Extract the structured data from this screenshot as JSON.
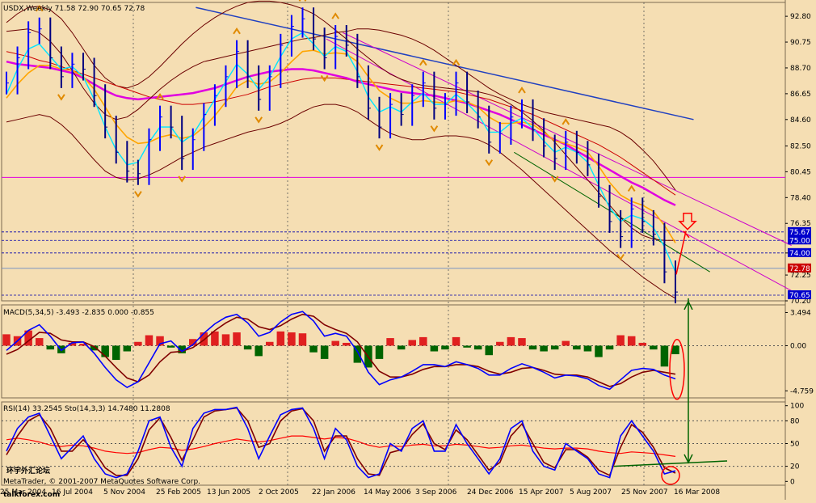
{
  "chart_data": [
    {
      "type": "line",
      "panel": "price",
      "title": "USDX,Weekly  71.58 72.90 70.65 72.78",
      "ohlc_last": {
        "open": 71.58,
        "high": 72.9,
        "low": 70.65,
        "close": 72.78
      },
      "y_ticks": [
        "92.80",
        "90.75",
        "88.70",
        "86.65",
        "84.60",
        "82.50",
        "80.45",
        "78.40",
        "76.35",
        "74.00",
        "72.25",
        "70.20"
      ],
      "price_labels": [
        {
          "text": "75.67",
          "value": 75.67,
          "fill": "#0000cc"
        },
        {
          "text": "75.00",
          "value": 75.0,
          "fill": "#0000cc"
        },
        {
          "text": "74.00",
          "value": 74.0,
          "fill": "#0000cc"
        },
        {
          "text": "72.78",
          "value": 72.78,
          "fill": "#cc0000"
        },
        {
          "text": "70.65",
          "value": 70.65,
          "fill": "#0000cc"
        }
      ],
      "ylim": [
        70.2,
        93.9
      ],
      "horizontal_levels": [
        75.67,
        75.0,
        74.0,
        70.65
      ],
      "current_price_line": 72.78,
      "magenta_level": 80.0,
      "series": [
        {
          "values": [
            87.5,
            89.5,
            91.5,
            91.8,
            89.5,
            88.0,
            89.0,
            88.6,
            86.5,
            84.0,
            82.0,
            80.5,
            80.3,
            83.0,
            84.8,
            84.0,
            81.5,
            83.0,
            85.0,
            86.5,
            88.0,
            90.0,
            88.0,
            86.2,
            88.0,
            90.5,
            92.0,
            92.6,
            91.0,
            89.5,
            91.2,
            90.5,
            88.0,
            85.5,
            84.0,
            85.8,
            85.0,
            86.5,
            87.5,
            85.5,
            85.8,
            87.5,
            86.0,
            84.8,
            82.8,
            83.5,
            84.8,
            85.3,
            83.8,
            82.5,
            81.5,
            82.8,
            82.0,
            81.0,
            78.5,
            76.5,
            75.3,
            77.5,
            76.5,
            75.5,
            72.5,
            70.9
          ]
        },
        {
          "values": [
            86.6,
            88.6,
            90.2,
            90.6,
            89.6,
            88.6,
            88.8,
            88.0,
            86.2,
            84.0,
            82.2,
            81.0,
            81.2,
            82.8,
            84.0,
            84.0,
            82.8,
            83.4,
            84.8,
            86.2,
            87.6,
            89.0,
            88.2,
            87.0,
            88.0,
            89.6,
            91.0,
            91.5,
            90.6,
            89.6,
            90.4,
            90.0,
            88.4,
            86.4,
            85.2,
            85.6,
            85.2,
            86.0,
            86.7,
            85.8,
            85.8,
            86.6,
            85.9,
            85.0,
            83.6,
            83.6,
            84.3,
            84.7,
            83.9,
            82.9,
            82.0,
            82.4,
            82.0,
            81.2,
            79.4,
            77.6,
            76.5,
            77.0,
            76.7,
            76.0,
            74.5,
            72.5
          ]
        },
        {
          "values": [
            86.3,
            87.4,
            88.3,
            88.9,
            88.9,
            88.6,
            88.5,
            88.0,
            87.0,
            85.6,
            84.2,
            83.2,
            82.7,
            82.8,
            83.2,
            83.4,
            83.1,
            83.3,
            84.0,
            84.9,
            86.0,
            87.2,
            87.7,
            87.4,
            87.6,
            88.3,
            89.2,
            90.0,
            90.1,
            89.8,
            89.9,
            89.8,
            89.2,
            88.0,
            86.9,
            86.3,
            85.9,
            85.9,
            86.1,
            86.0,
            85.9,
            86.1,
            86.0,
            85.6,
            84.8,
            84.3,
            84.3,
            84.4,
            84.2,
            83.6,
            82.9,
            82.7,
            82.4,
            82.0,
            80.9,
            79.6,
            78.6,
            78.1,
            77.8,
            77.3,
            76.2,
            74.8
          ]
        },
        {
          "values": [
            89.2,
            89.0,
            88.9,
            88.8,
            88.7,
            88.5,
            88.3,
            87.9,
            87.4,
            86.9,
            86.5,
            86.3,
            86.2,
            86.3,
            86.4,
            86.5,
            86.6,
            86.7,
            86.9,
            87.1,
            87.4,
            87.7,
            88.0,
            88.2,
            88.4,
            88.5,
            88.6,
            88.6,
            88.5,
            88.3,
            88.1,
            87.9,
            87.6,
            87.4,
            87.2,
            87.0,
            86.8,
            86.7,
            86.6,
            86.5,
            86.3,
            86.1,
            85.9,
            85.6,
            85.3,
            85.0,
            84.6,
            84.2,
            83.8,
            83.4,
            83.0,
            82.6,
            82.1,
            81.6,
            81.1,
            80.6,
            80.1,
            79.6,
            79.2,
            78.7,
            78.2,
            77.8
          ]
        },
        {
          "values": [
            90.0,
            89.8,
            89.6,
            89.3,
            89.1,
            88.8,
            88.5,
            88.2,
            87.9,
            87.6,
            87.3,
            87.0,
            86.7,
            86.4,
            86.2,
            86.0,
            85.8,
            85.8,
            85.9,
            86.0,
            86.2,
            86.4,
            86.6,
            86.9,
            87.2,
            87.4,
            87.6,
            87.8,
            87.9,
            87.9,
            87.9,
            87.8,
            87.7,
            87.6,
            87.5,
            87.4,
            87.3,
            87.2,
            87.1,
            87.0,
            86.9,
            86.8,
            86.6,
            86.4,
            86.2,
            85.9,
            85.6,
            85.3,
            85.0,
            84.6,
            84.2,
            83.8,
            83.4,
            83.0,
            82.6,
            82.1,
            81.6,
            81.0,
            80.4,
            79.8,
            79.2,
            78.6
          ]
        },
        {
          "values": [
            91.6,
            91.7,
            91.8,
            91.5,
            90.8,
            89.8,
            88.5,
            87.1,
            85.9,
            85.0,
            84.6,
            84.8,
            85.4,
            86.2,
            87.0,
            87.7,
            88.3,
            88.8,
            89.2,
            89.4,
            89.6,
            89.8,
            90.0,
            90.2,
            90.4,
            90.6,
            90.8,
            91.0,
            91.1,
            91.3,
            91.5,
            91.6,
            91.8,
            91.8,
            91.7,
            91.5,
            91.3,
            91.0,
            90.6,
            90.1,
            89.5,
            88.9,
            88.3,
            87.7,
            87.1,
            86.6,
            86.2,
            85.8,
            85.5,
            85.2,
            85.0,
            84.8,
            84.6,
            84.4,
            84.2,
            84.0,
            83.6,
            83.0,
            82.2,
            81.3,
            80.2,
            79.0
          ]
        },
        {
          "values": [
            92.3,
            93.0,
            93.5,
            93.6,
            93.3,
            92.6,
            91.5,
            90.2,
            88.9,
            87.9,
            87.3,
            87.1,
            87.4,
            88.0,
            88.8,
            89.7,
            90.6,
            91.4,
            92.1,
            92.7,
            93.2,
            93.6,
            93.9,
            94.0,
            94.0,
            93.9,
            93.7,
            93.4,
            93.0,
            92.4,
            91.7,
            91.0,
            90.2,
            89.5,
            88.8,
            88.2,
            87.8,
            87.5,
            87.3,
            87.2,
            87.1,
            87.0,
            86.9,
            86.8,
            86.6,
            86.3,
            85.8,
            85.2,
            84.5,
            83.7,
            82.8,
            81.8,
            80.8,
            79.8,
            78.8,
            77.8,
            76.8,
            76.0,
            75.4,
            75.1,
            75.0,
            75.0
          ]
        },
        {
          "values": [
            84.4,
            84.6,
            84.8,
            85.0,
            84.8,
            84.2,
            83.4,
            82.4,
            81.4,
            80.5,
            80.0,
            79.8,
            79.9,
            80.2,
            80.6,
            81.1,
            81.6,
            82.0,
            82.4,
            82.7,
            83.0,
            83.3,
            83.6,
            83.8,
            84.0,
            84.3,
            84.7,
            85.2,
            85.6,
            85.8,
            85.8,
            85.6,
            85.2,
            84.6,
            84.0,
            83.5,
            83.2,
            83.0,
            83.0,
            83.2,
            83.3,
            83.3,
            83.2,
            83.0,
            82.6,
            82.0,
            81.3,
            80.6,
            79.8,
            79.0,
            78.2,
            77.4,
            76.6,
            75.8,
            75.0,
            74.2,
            73.5,
            72.8,
            72.1,
            71.5,
            70.9,
            70.4
          ]
        }
      ],
      "blue_ma_line": {
        "x": [
          0.24,
          0.85
        ],
        "y": [
          93.5,
          84.6
        ]
      },
      "trend_lines": [
        {
          "x": [
            0.42,
            0.97
          ],
          "y": [
            91.5,
            74.6
          ]
        },
        {
          "x": [
            0.4,
            0.97
          ],
          "y": [
            91.0,
            71.0
          ]
        },
        {
          "x": [
            0.63,
            0.87
          ],
          "y": [
            82.0,
            72.5
          ]
        }
      ]
    },
    {
      "type": "bar",
      "panel": "macd",
      "title": "MACD(5,34,5) -3.493 -2.835 0.000 -0.855",
      "y_ticks": [
        "3.494",
        "0.00",
        "-4.759"
      ],
      "ylim": [
        -5.5,
        4.3
      ],
      "histogram": [
        1.2,
        1.0,
        1.6,
        0.8,
        -0.4,
        -0.8,
        0.3,
        0.2,
        -0.5,
        -1.2,
        -1.5,
        -0.6,
        0.4,
        1.1,
        1.0,
        -0.2,
        -0.8,
        0.7,
        1.4,
        1.5,
        1.2,
        1.4,
        -0.4,
        -1.1,
        0.4,
        1.5,
        1.4,
        1.3,
        -0.7,
        -1.4,
        0.5,
        0.3,
        -1.8,
        -2.3,
        -1.4,
        0.8,
        -0.4,
        0.6,
        0.9,
        -0.6,
        -0.4,
        0.9,
        -0.2,
        -0.4,
        -1.0,
        0.4,
        0.9,
        0.8,
        -0.4,
        -0.6,
        -0.4,
        0.5,
        -0.4,
        -0.6,
        -1.2,
        -0.4,
        1.1,
        1.0,
        0.3,
        -0.4,
        -2.2,
        -0.9
      ],
      "macd_line": [
        -0.5,
        0.5,
        1.6,
        2.2,
        1.0,
        -0.5,
        0.3,
        0.4,
        -0.8,
        -2.3,
        -3.6,
        -4.4,
        -3.8,
        -1.8,
        0.2,
        0.5,
        -0.6,
        0.1,
        1.3,
        2.3,
        3.0,
        3.3,
        2.4,
        1.0,
        1.4,
        2.5,
        3.3,
        3.6,
        2.6,
        1.0,
        1.3,
        1.0,
        -0.6,
        -2.8,
        -4.1,
        -3.6,
        -3.3,
        -2.7,
        -2.0,
        -2.0,
        -2.2,
        -1.7,
        -2.0,
        -2.4,
        -3.1,
        -3.1,
        -2.4,
        -1.9,
        -2.3,
        -2.8,
        -3.4,
        -3.1,
        -3.2,
        -3.5,
        -4.2,
        -4.6,
        -3.6,
        -2.6,
        -2.4,
        -2.5,
        -3.1,
        -3.5
      ],
      "signal_line": [
        -0.9,
        -0.4,
        0.5,
        1.4,
        1.3,
        0.6,
        0.4,
        0.4,
        -0.1,
        -1.1,
        -2.3,
        -3.4,
        -3.8,
        -3.1,
        -1.7,
        -0.7,
        -0.6,
        -0.2,
        0.6,
        1.6,
        2.4,
        3.0,
        2.8,
        2.0,
        1.7,
        2.1,
        2.8,
        3.3,
        3.1,
        2.2,
        1.7,
        1.3,
        0.4,
        -1.2,
        -2.7,
        -3.3,
        -3.3,
        -3.0,
        -2.5,
        -2.2,
        -2.2,
        -2.0,
        -2.0,
        -2.2,
        -2.7,
        -3.0,
        -2.8,
        -2.4,
        -2.3,
        -2.6,
        -3.0,
        -3.1,
        -3.1,
        -3.3,
        -3.8,
        -4.3,
        -4.0,
        -3.3,
        -2.8,
        -2.6,
        -2.8,
        -3.0
      ]
    },
    {
      "type": "line",
      "panel": "rsi_stoch",
      "title": "RSI(14) 33.2545  Sto(14,3,3) 14.7480 11.2808",
      "y_ticks": [
        "100",
        "80",
        "50",
        "20",
        "0"
      ],
      "ylim": [
        -5,
        105
      ],
      "series": [
        {
          "values": [
            55,
            57,
            55,
            52,
            48,
            46,
            48,
            47,
            44,
            40,
            38,
            37,
            38,
            42,
            45,
            44,
            41,
            43,
            46,
            50,
            53,
            56,
            54,
            52,
            54,
            57,
            60,
            60,
            58,
            56,
            58,
            57,
            53,
            48,
            45,
            47,
            46,
            48,
            49,
            47,
            47,
            49,
            48,
            46,
            44,
            45,
            47,
            48,
            46,
            44,
            43,
            44,
            44,
            43,
            40,
            38,
            37,
            39,
            38,
            37,
            35,
            33
          ]
        },
        {
          "values": [
            40,
            70,
            85,
            90,
            60,
            30,
            45,
            60,
            30,
            10,
            5,
            10,
            40,
            80,
            85,
            45,
            20,
            70,
            90,
            95,
            95,
            98,
            70,
            30,
            60,
            88,
            95,
            97,
            70,
            30,
            70,
            55,
            20,
            5,
            10,
            50,
            40,
            70,
            80,
            40,
            40,
            75,
            50,
            30,
            10,
            30,
            70,
            80,
            40,
            20,
            15,
            50,
            40,
            30,
            10,
            5,
            60,
            80,
            60,
            40,
            10,
            14
          ]
        },
        {
          "values": [
            35,
            60,
            80,
            88,
            70,
            40,
            40,
            55,
            40,
            18,
            8,
            8,
            30,
            68,
            84,
            58,
            28,
            55,
            85,
            93,
            95,
            97,
            80,
            45,
            50,
            80,
            93,
            96,
            80,
            40,
            60,
            60,
            30,
            10,
            8,
            38,
            42,
            62,
            76,
            50,
            42,
            68,
            55,
            35,
            15,
            25,
            60,
            76,
            50,
            25,
            18,
            42,
            42,
            32,
            15,
            8,
            45,
            75,
            65,
            45,
            18,
            11
          ]
        }
      ]
    }
  ],
  "price_title": "USDX,Weekly  71.58 72.90 70.65 72.78",
  "x_axis_labels": [
    "25 Mar 2004",
    "16 Jul 2004",
    "5 Nov 2004",
    "25 Feb 2005",
    "13 Jun 2005",
    "2 Oct 2005",
    "22 Jan 2006",
    "14 May 2006",
    "3 Sep 2006",
    "24 Dec 2006",
    "15 Apr 2007",
    "5 Aug 2007",
    "25 Nov 2007",
    "16 Mar 2008"
  ],
  "watermark": {
    "top": "MetaTrader, © 2001-2007 MetaQuotes Software Corp.",
    "logo": "talkforex.com",
    "logo_cn": "环宇外汇论坛"
  },
  "colors": {
    "background": "#f5deb3",
    "bull": "#0000ff",
    "bear": "#000080",
    "ma_fast": "#00e5ff",
    "ma_mid": "#ffa500",
    "ma_slow": "#cc0000",
    "ma_magenta": "#e000e0",
    "blue_ma": "#2040c0",
    "bands": "#6b0000",
    "trend": "#cc00cc",
    "green": "#006400",
    "annotation": "#ff0000"
  }
}
